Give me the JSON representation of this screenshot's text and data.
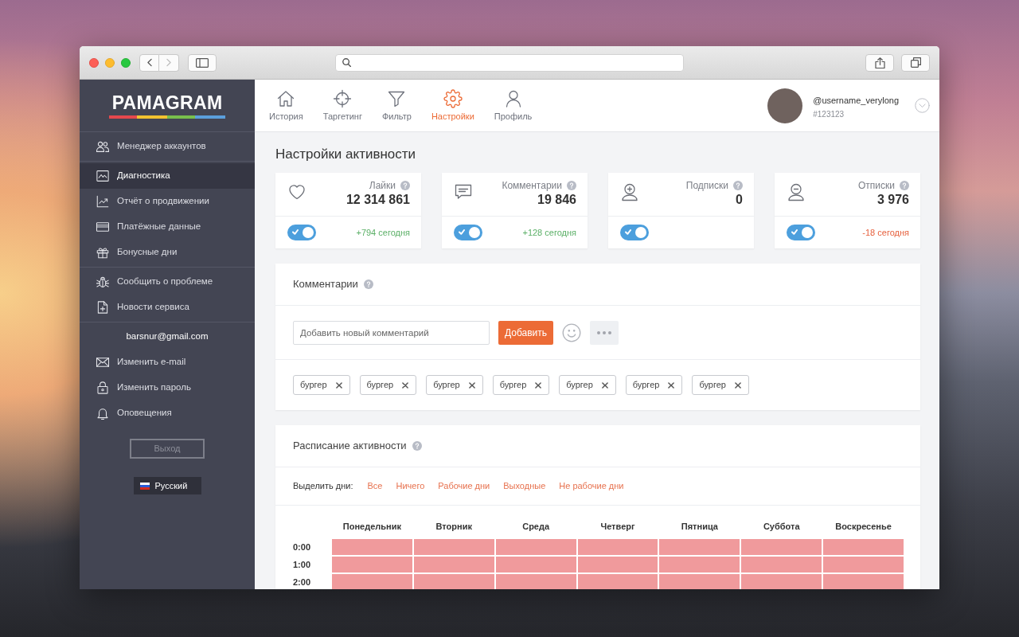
{
  "browser": {
    "back": {
      "disabled": false
    },
    "forward": {
      "disabled": true
    }
  },
  "sidebar": {
    "logo": "PAMAGRAM",
    "sections": [
      {
        "items": [
          {
            "label": "Менеджер аккаунтов",
            "selected": false
          }
        ]
      },
      {
        "items": [
          {
            "label": "Диагностика",
            "selected": true
          },
          {
            "label": "Отчёт о продвижении",
            "selected": false
          },
          {
            "label": "Платёжные данные",
            "selected": false
          },
          {
            "label": "Бонусные дни",
            "selected": false
          }
        ]
      },
      {
        "items": [
          {
            "label": "Сообщить о проблеме",
            "selected": false
          },
          {
            "label": "Новости сервиса",
            "selected": false
          }
        ]
      },
      {
        "email": "barsnur@gmail.com",
        "items": [
          {
            "label": "Изменить e-mail",
            "selected": false
          },
          {
            "label": "Изменить пароль",
            "selected": false
          },
          {
            "label": "Оповещения",
            "selected": false
          }
        ]
      }
    ],
    "logout": "Выход",
    "language": "Русский"
  },
  "nav": {
    "tabs": [
      {
        "label": "История",
        "selected": false
      },
      {
        "label": "Таргетинг",
        "selected": false
      },
      {
        "label": "Фильтр",
        "selected": false
      },
      {
        "label": "Настройки",
        "selected": true
      },
      {
        "label": "Профиль",
        "selected": false
      }
    ],
    "user": {
      "handle": "@username_verylong",
      "id": "#123123"
    }
  },
  "page_title": "Настройки активности",
  "stats": [
    {
      "label": "Лайки",
      "value": "12 314 861",
      "on": true,
      "today": "+794 сегодня",
      "color": "#5aaf66"
    },
    {
      "label": "Комментарии",
      "value": "19 846",
      "on": true,
      "today": "+128 сегодня",
      "color": "#5aaf66"
    },
    {
      "label": "Подписки",
      "value": "0",
      "on": true
    },
    {
      "label": "Отписки",
      "value": "3 976",
      "on": true,
      "today": "-18 сегодня",
      "color": "#e6603d"
    }
  ],
  "comments": {
    "title": "Комментарии",
    "input": {
      "placeholder": "Добавить новый комментарий"
    },
    "add_button": "Добавить",
    "tags": [
      "бургер",
      "бургер",
      "бургер",
      "бургер",
      "бургер",
      "бургер",
      "бургер"
    ]
  },
  "schedule": {
    "title": "Расписание активности",
    "filter_label": "Выделить дни:",
    "filters": [
      "Все",
      "Ничего",
      "Рабочие дни",
      "Выходные",
      "Не рабочие дни"
    ],
    "days": [
      "Понедельник",
      "Вторник",
      "Среда",
      "Четверг",
      "Пятница",
      "Суббота",
      "Воскресенье"
    ],
    "rows": [
      {
        "time": "0:00",
        "slots": [
          {
            "selected": true
          },
          {
            "selected": true
          },
          {
            "selected": true
          },
          {
            "selected": true
          },
          {
            "selected": true
          },
          {
            "selected": true
          },
          {
            "selected": true
          }
        ]
      },
      {
        "time": "1:00",
        "slots": [
          {
            "selected": true
          },
          {
            "selected": true
          },
          {
            "selected": true
          },
          {
            "selected": true
          },
          {
            "selected": true
          },
          {
            "selected": true
          },
          {
            "selected": true
          }
        ]
      },
      {
        "time": "2:00",
        "slots": [
          {
            "selected": true
          },
          {
            "selected": true
          },
          {
            "selected": true
          },
          {
            "selected": true
          },
          {
            "selected": true
          },
          {
            "selected": true
          },
          {
            "selected": true
          }
        ]
      }
    ]
  }
}
